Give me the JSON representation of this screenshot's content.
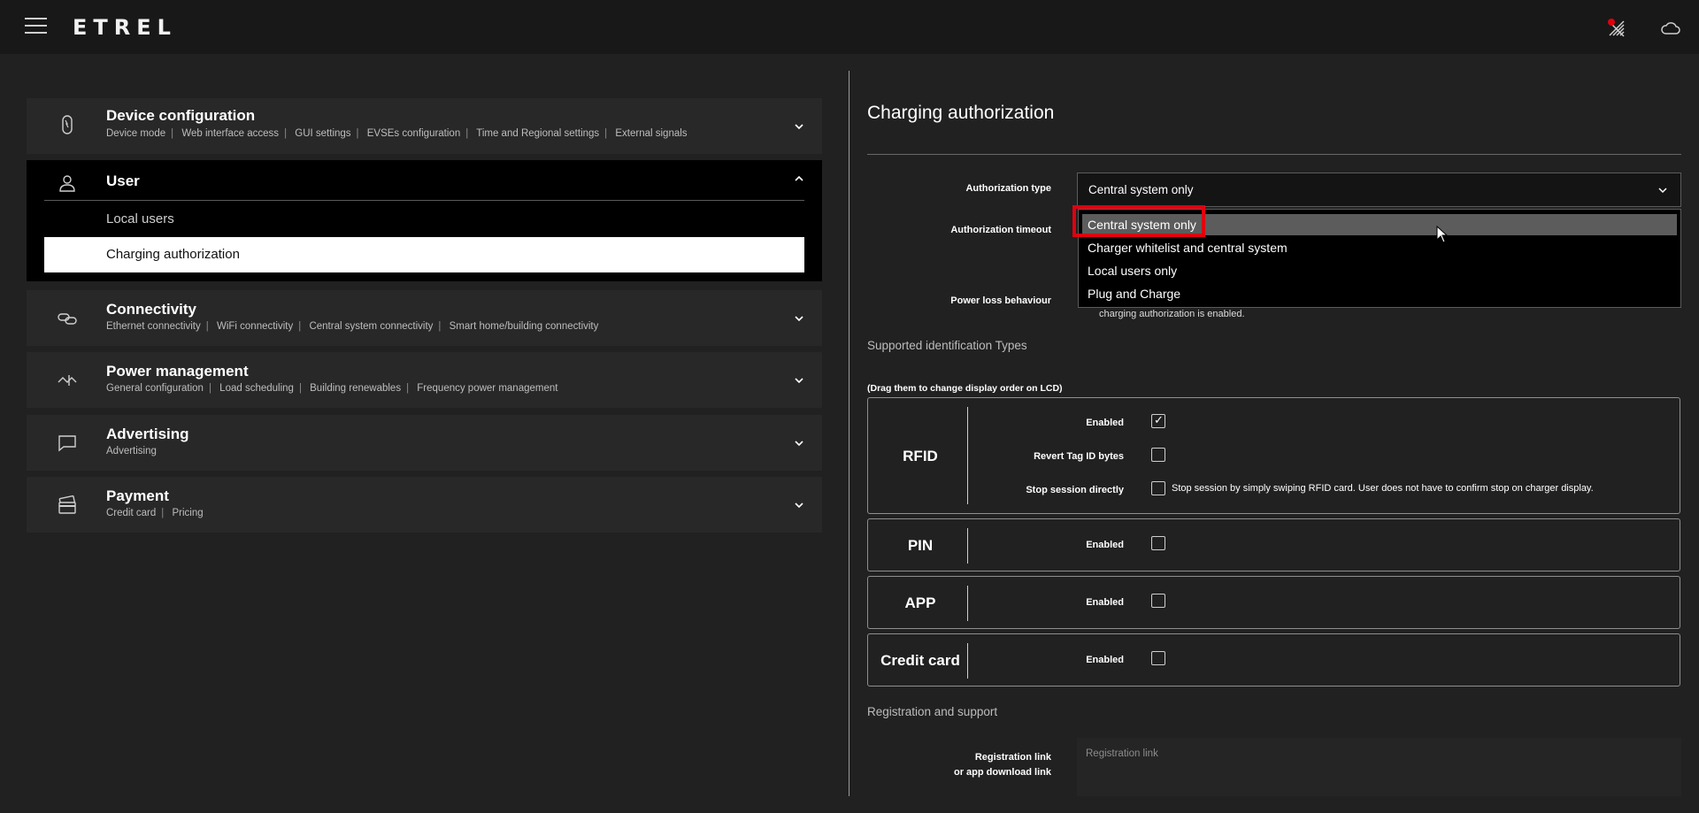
{
  "app": {
    "logo": "ETREL"
  },
  "left": {
    "device": {
      "title": "Device configuration",
      "subs": [
        "Device mode",
        "Web interface access",
        "GUI settings",
        "EVSEs configuration",
        "Time and Regional settings",
        "External signals"
      ]
    },
    "user": {
      "title": "User",
      "items": [
        "Local users",
        "Charging authorization"
      ]
    },
    "connectivity": {
      "title": "Connectivity",
      "subs": [
        "Ethernet connectivity",
        "WiFi connectivity",
        "Central system connectivity",
        "Smart home/building connectivity"
      ]
    },
    "power": {
      "title": "Power management",
      "subs": [
        "General configuration",
        "Load scheduling",
        "Building renewables",
        "Frequency power management"
      ]
    },
    "advertising": {
      "title": "Advertising",
      "subs": [
        "Advertising"
      ]
    },
    "payment": {
      "title": "Payment",
      "subs": [
        "Credit card",
        "Pricing"
      ]
    }
  },
  "right": {
    "title": "Charging authorization",
    "labels": {
      "auth_type": "Authorization type",
      "auth_timeout": "Authorization timeout",
      "power_loss": "Power loss behaviour"
    },
    "auth_type_value": "Central system only",
    "dropdown_options": [
      "Central system only",
      "Charger whitelist and central system",
      "Local users only",
      "Plug and Charge"
    ],
    "power_loss_note": "charging authorization is enabled.",
    "supported_types_heading": "Supported identification Types",
    "drag_note": "(Drag them to change display order on LCD)",
    "rfid": {
      "name": "RFID",
      "enabled_label": "Enabled",
      "revert_label": "Revert Tag ID bytes",
      "stop_label": "Stop session directly",
      "stop_desc": "Stop session by simply swiping RFID card. User does not have to confirm stop on charger display."
    },
    "pin": {
      "name": "PIN",
      "enabled_label": "Enabled"
    },
    "app": {
      "name": "APP",
      "enabled_label": "Enabled"
    },
    "credit": {
      "name": "Credit card",
      "enabled_label": "Enabled"
    },
    "registration_heading": "Registration and support",
    "registration_label_1": "Registration link",
    "registration_label_2": "or app download link",
    "registration_placeholder": "Registration link"
  }
}
